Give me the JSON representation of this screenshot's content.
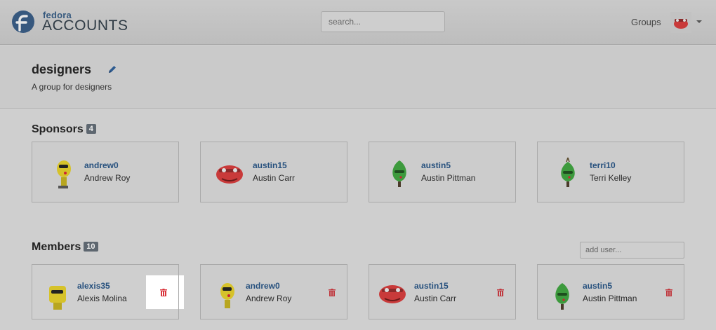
{
  "header": {
    "logo_small": "fedora",
    "logo_big": "ACCOUNTS",
    "search_placeholder": "search...",
    "nav_groups": "Groups"
  },
  "group": {
    "name": "designers",
    "description": "A group for designers"
  },
  "sponsors": {
    "title": "Sponsors",
    "count": "4",
    "items": [
      {
        "username": "andrew0",
        "fullname": "Andrew Roy",
        "avatar": "yellow-robot-avatar"
      },
      {
        "username": "austin15",
        "fullname": "Austin Carr",
        "avatar": "red-monster-avatar"
      },
      {
        "username": "austin5",
        "fullname": "Austin Pittman",
        "avatar": "green-tree-avatar"
      },
      {
        "username": "terri10",
        "fullname": "Terri Kelley",
        "avatar": "green-tree-avatar"
      }
    ]
  },
  "members": {
    "title": "Members",
    "count": "10",
    "add_placeholder": "add user...",
    "items": [
      {
        "username": "alexis35",
        "fullname": "Alexis Molina",
        "avatar": "yellow-robot-avatar"
      },
      {
        "username": "andrew0",
        "fullname": "Andrew Roy",
        "avatar": "yellow-robot-avatar"
      },
      {
        "username": "austin15",
        "fullname": "Austin Carr",
        "avatar": "red-monster-avatar"
      },
      {
        "username": "austin5",
        "fullname": "Austin Pittman",
        "avatar": "green-tree-avatar"
      }
    ]
  },
  "icons": {
    "logo": "fedora-logo-icon",
    "edit": "pencil-icon",
    "remove": "trash-icon",
    "menu": "caret-down-icon"
  },
  "colors": {
    "link": "#27517e",
    "danger": "#d9353d",
    "badge": "#5e6770"
  }
}
